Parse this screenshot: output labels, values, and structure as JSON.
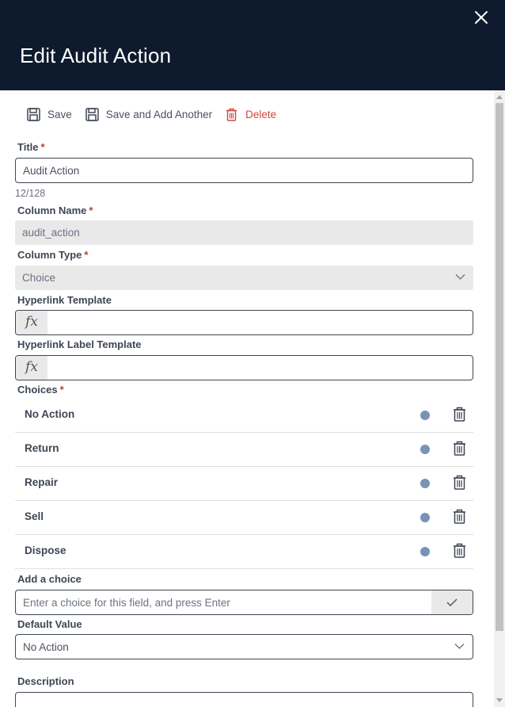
{
  "header": {
    "title": "Edit Audit Action"
  },
  "toolbar": {
    "save_label": "Save",
    "save_add_label": "Save and Add Another",
    "delete_label": "Delete"
  },
  "form": {
    "title": {
      "label": "Title",
      "required_mark": "*",
      "value": "Audit Action",
      "counter": "12/128"
    },
    "column_name": {
      "label": "Column Name",
      "required_mark": "*",
      "value": "audit_action"
    },
    "column_type": {
      "label": "Column Type",
      "required_mark": "*",
      "value": "Choice"
    },
    "hyperlink_template": {
      "label": "Hyperlink Template",
      "fx": "fx",
      "value": ""
    },
    "hyperlink_label_template": {
      "label": "Hyperlink Label Template",
      "fx": "fx",
      "value": ""
    },
    "choices": {
      "label": "Choices",
      "required_mark": "*",
      "items": [
        {
          "label": "No Action"
        },
        {
          "label": "Return"
        },
        {
          "label": "Repair"
        },
        {
          "label": "Sell"
        },
        {
          "label": "Dispose"
        }
      ]
    },
    "add_choice": {
      "label": "Add a choice",
      "placeholder": "Enter a choice for this field, and press Enter"
    },
    "default_value": {
      "label": "Default Value",
      "value": "No Action"
    },
    "description": {
      "label": "Description",
      "value": ""
    }
  },
  "icons": {
    "close": "close-icon",
    "save": "floppy-disk-icon",
    "save_add": "floppy-disk-icon",
    "delete": "trash-icon",
    "dropdown": "chevron-down-icon",
    "confirm": "checkmark-icon",
    "choice_color": "color-dot-icon"
  },
  "colors": {
    "header_bg": "#0e1a2e",
    "delete": "#d0463f",
    "required": "#c0392b",
    "choice_dot": "#7a93b5"
  }
}
